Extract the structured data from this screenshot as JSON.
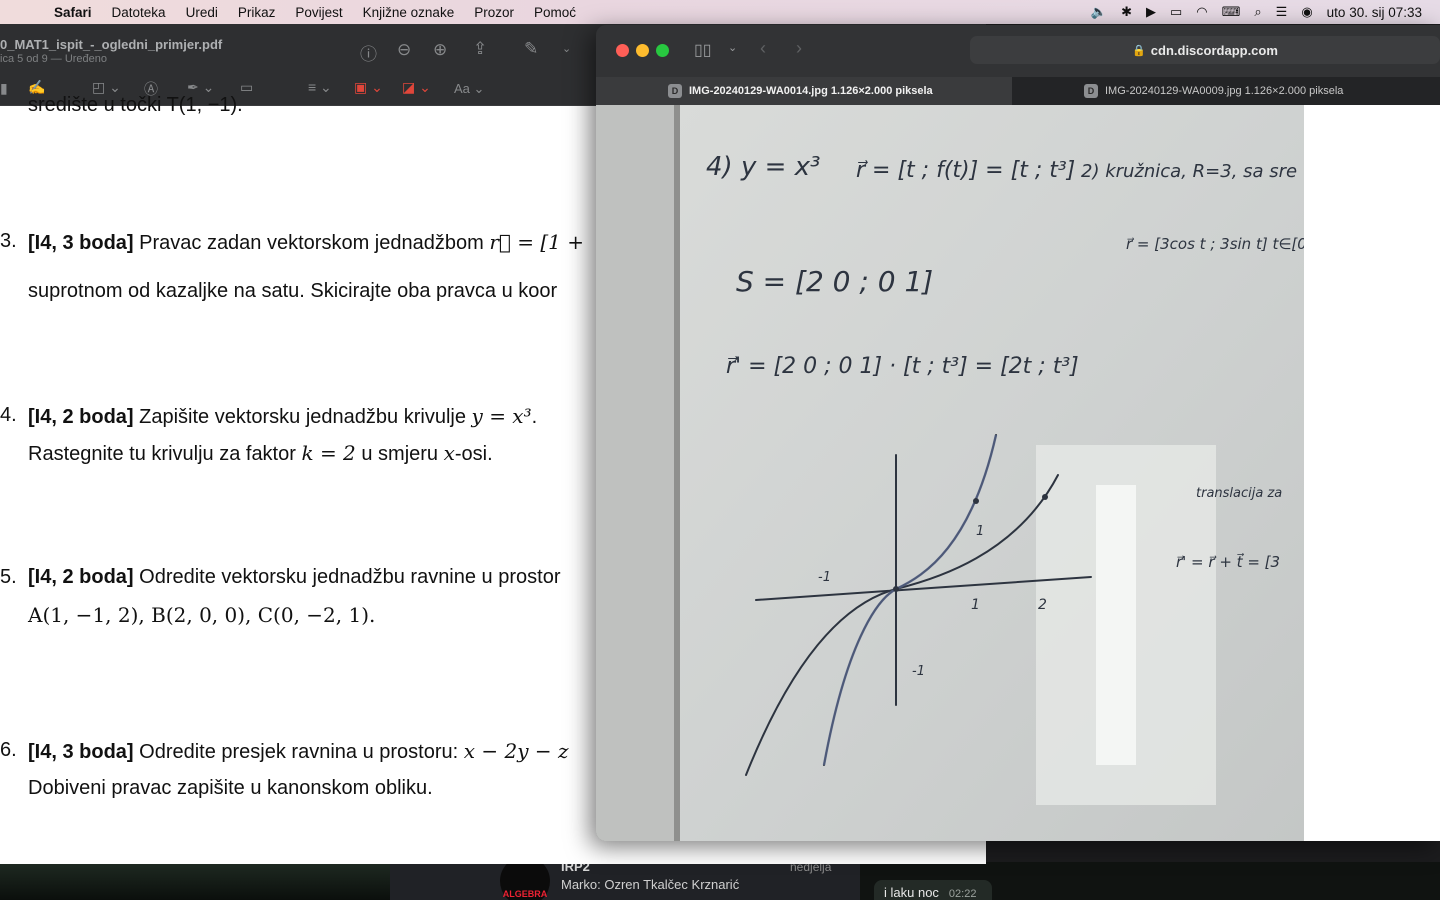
{
  "menubar": {
    "app": "Safari",
    "items": [
      "Datoteka",
      "Uredi",
      "Prikaz",
      "Povijest",
      "Knjižne oznake",
      "Prozor",
      "Pomoć"
    ],
    "clock": "uto 30. sij  07:33",
    "status_icons": [
      "volume-icon",
      "bluetooth-icon",
      "play-icon",
      "battery-icon",
      "wifi-icon",
      "keyboard-icon",
      "search-icon",
      "control-center-icon",
      "siri-icon"
    ]
  },
  "preview": {
    "title": "0_MAT1_ispit_-_ogledni_primjer.pdf",
    "subtitle": "ica 5 od 9 — Uređeno",
    "toolbar2": {
      "aa": "Aa"
    },
    "lines": {
      "l0": "središte u točki T(1, −1).",
      "q3_num": "3.",
      "q3_bold": "[I4, 3 boda]",
      "q3_text": " Pravac zadan vektorskom jednadžbom ",
      "q3_math": "r⃗ = [1 +",
      "q3_line2": "suprotnom od kazaljke na satu. Skicirajte oba pravca u koor",
      "q4_num": "4.",
      "q4_bold": "[I4, 2 boda]",
      "q4_text": " Zapišite vektorsku jednadžbu krivulje ",
      "q4_math": "y = x³",
      "q4_line2a": "Rastegnite tu krivulju za faktor ",
      "q4_line2m": "k = 2",
      "q4_line2b": " u smjeru ",
      "q4_line2m2": "x",
      "q4_line2c": "-osi.",
      "q5_num": "5.",
      "q5_bold": "[I4, 2 boda]",
      "q5_text": " Odredite vektorsku jednadžbu ravnine u prostor",
      "q5_line2": "A(1, −1, 2), B(2, 0, 0), C(0, −2, 1).",
      "q6_num": "6.",
      "q6_bold": "[I4, 3 boda]",
      "q6_text": " Odredite presjek ravnina u prostoru: ",
      "q6_math": "x − 2y − z",
      "q6_line2": "Dobiveni pravac zapišite u kanonskom obliku."
    }
  },
  "safari": {
    "url": "cdn.discordapp.com",
    "tabs": [
      {
        "label": "IMG-20240129-WA0014.jpg 1.126×2.000 piksela",
        "favicon": "D",
        "active": true
      },
      {
        "label": "IMG-20240129-WA0009.jpg 1.126×2.000 piksela",
        "favicon": "D",
        "active": false
      }
    ],
    "whiteboard": {
      "w1": "4)  y = x³",
      "w2": "r⃗ = [t ; f(t)] = [t ; t³]",
      "w3": "2)  kružnica, R=3, sa sre",
      "w4": "S = [2 0 ; 0 1]",
      "w5": "r⃗ = [3cos t ; 3sin t]  t∈[0,2",
      "w6": "r⃗' = [2 0 ; 0 1] · [t ; t³] = [2t ; t³]",
      "w7": "translacija za",
      "w8": "r⃗' = r⃗ + t⃗ = [3",
      "axis_labels": [
        "1",
        "2",
        "-1",
        "-1",
        "1"
      ]
    }
  },
  "chat": {
    "title": "IRP2",
    "preview": "Marko: Ozren Tkalčec Krznarić",
    "day": "nedjelja",
    "bubble": "i laku noc",
    "bubble_time": "02:22",
    "avatar_text": "ALGEBRA"
  },
  "colors": {
    "close": "#ff5f57",
    "minimize": "#febc2e",
    "zoom": "#28c840"
  }
}
